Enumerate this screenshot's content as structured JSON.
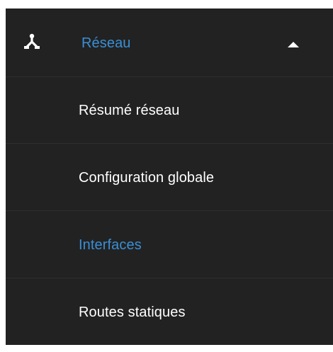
{
  "menu": {
    "header": {
      "label": "Réseau",
      "icon": "network-icon",
      "expanded_indicator": "chevron-up-icon"
    },
    "items": [
      {
        "label": "Résumé réseau",
        "active": false
      },
      {
        "label": "Configuration globale",
        "active": false
      },
      {
        "label": "Interfaces",
        "active": true
      },
      {
        "label": "Routes statiques",
        "active": false
      }
    ]
  },
  "colors": {
    "background": "#222222",
    "text": "#ffffff",
    "accent": "#3a8fd6",
    "divider": "#2f2f2f"
  }
}
